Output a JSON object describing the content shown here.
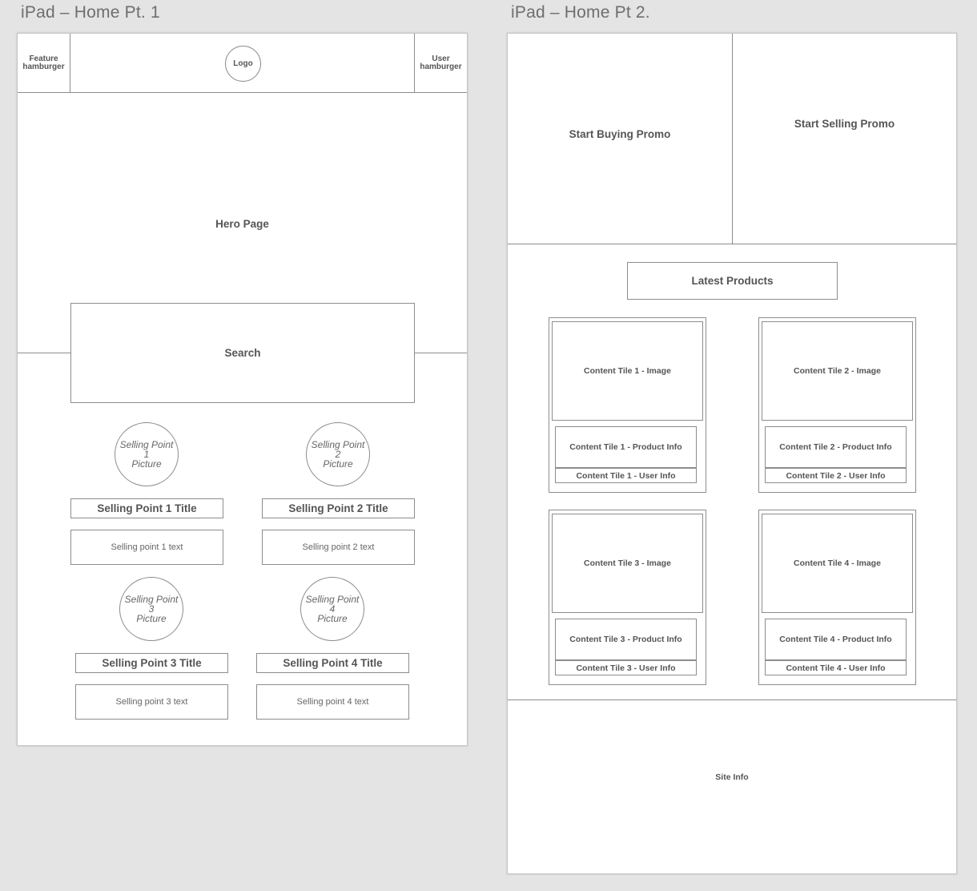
{
  "artboards": {
    "left_title": "iPad – Home Pt. 1",
    "right_title": "iPad – Home Pt 2."
  },
  "pt1": {
    "header": {
      "feature_line1": "Feature",
      "feature_line2": "hamburger",
      "logo": "Logo",
      "user_line1": "User",
      "user_line2": "hamburger"
    },
    "hero": "Hero Page",
    "search": "Search",
    "selling_points": [
      {
        "pic1": "Selling Point",
        "pic2": "1",
        "pic3": "Picture",
        "title": "Selling Point 1 Title",
        "text": "Selling point 1 text"
      },
      {
        "pic1": "Selling Point",
        "pic2": "2",
        "pic3": "Picture",
        "title": "Selling Point 2 Title",
        "text": "Selling point 2 text"
      },
      {
        "pic1": "Selling Point",
        "pic2": "3",
        "pic3": "Picture",
        "title": "Selling Point 3 Title",
        "text": "Selling point 3 text"
      },
      {
        "pic1": "Selling Point",
        "pic2": "4",
        "pic3": "Picture",
        "title": "Selling Point 4 Title",
        "text": "Selling point 4 text"
      }
    ]
  },
  "pt2": {
    "promo_buying": "Start Buying Promo",
    "promo_selling": "Start Selling Promo",
    "latest_products": "Latest Products",
    "tiles": [
      {
        "image": "Content Tile 1 - Image",
        "product": "Content Tile 1 - Product Info",
        "user": "Content Tile 1 - User Info"
      },
      {
        "image": "Content Tile 2 - Image",
        "product": "Content Tile 2 - Product Info",
        "user": "Content Tile 2 - User Info"
      },
      {
        "image": "Content Tile 3 - Image",
        "product": "Content Tile 3 - Product Info",
        "user": "Content Tile 3 - User Info"
      },
      {
        "image": "Content Tile 4 - Image",
        "product": "Content Tile 4 - Product Info",
        "user": "Content Tile 4 - User Info"
      }
    ],
    "site_info": "Site Info"
  }
}
